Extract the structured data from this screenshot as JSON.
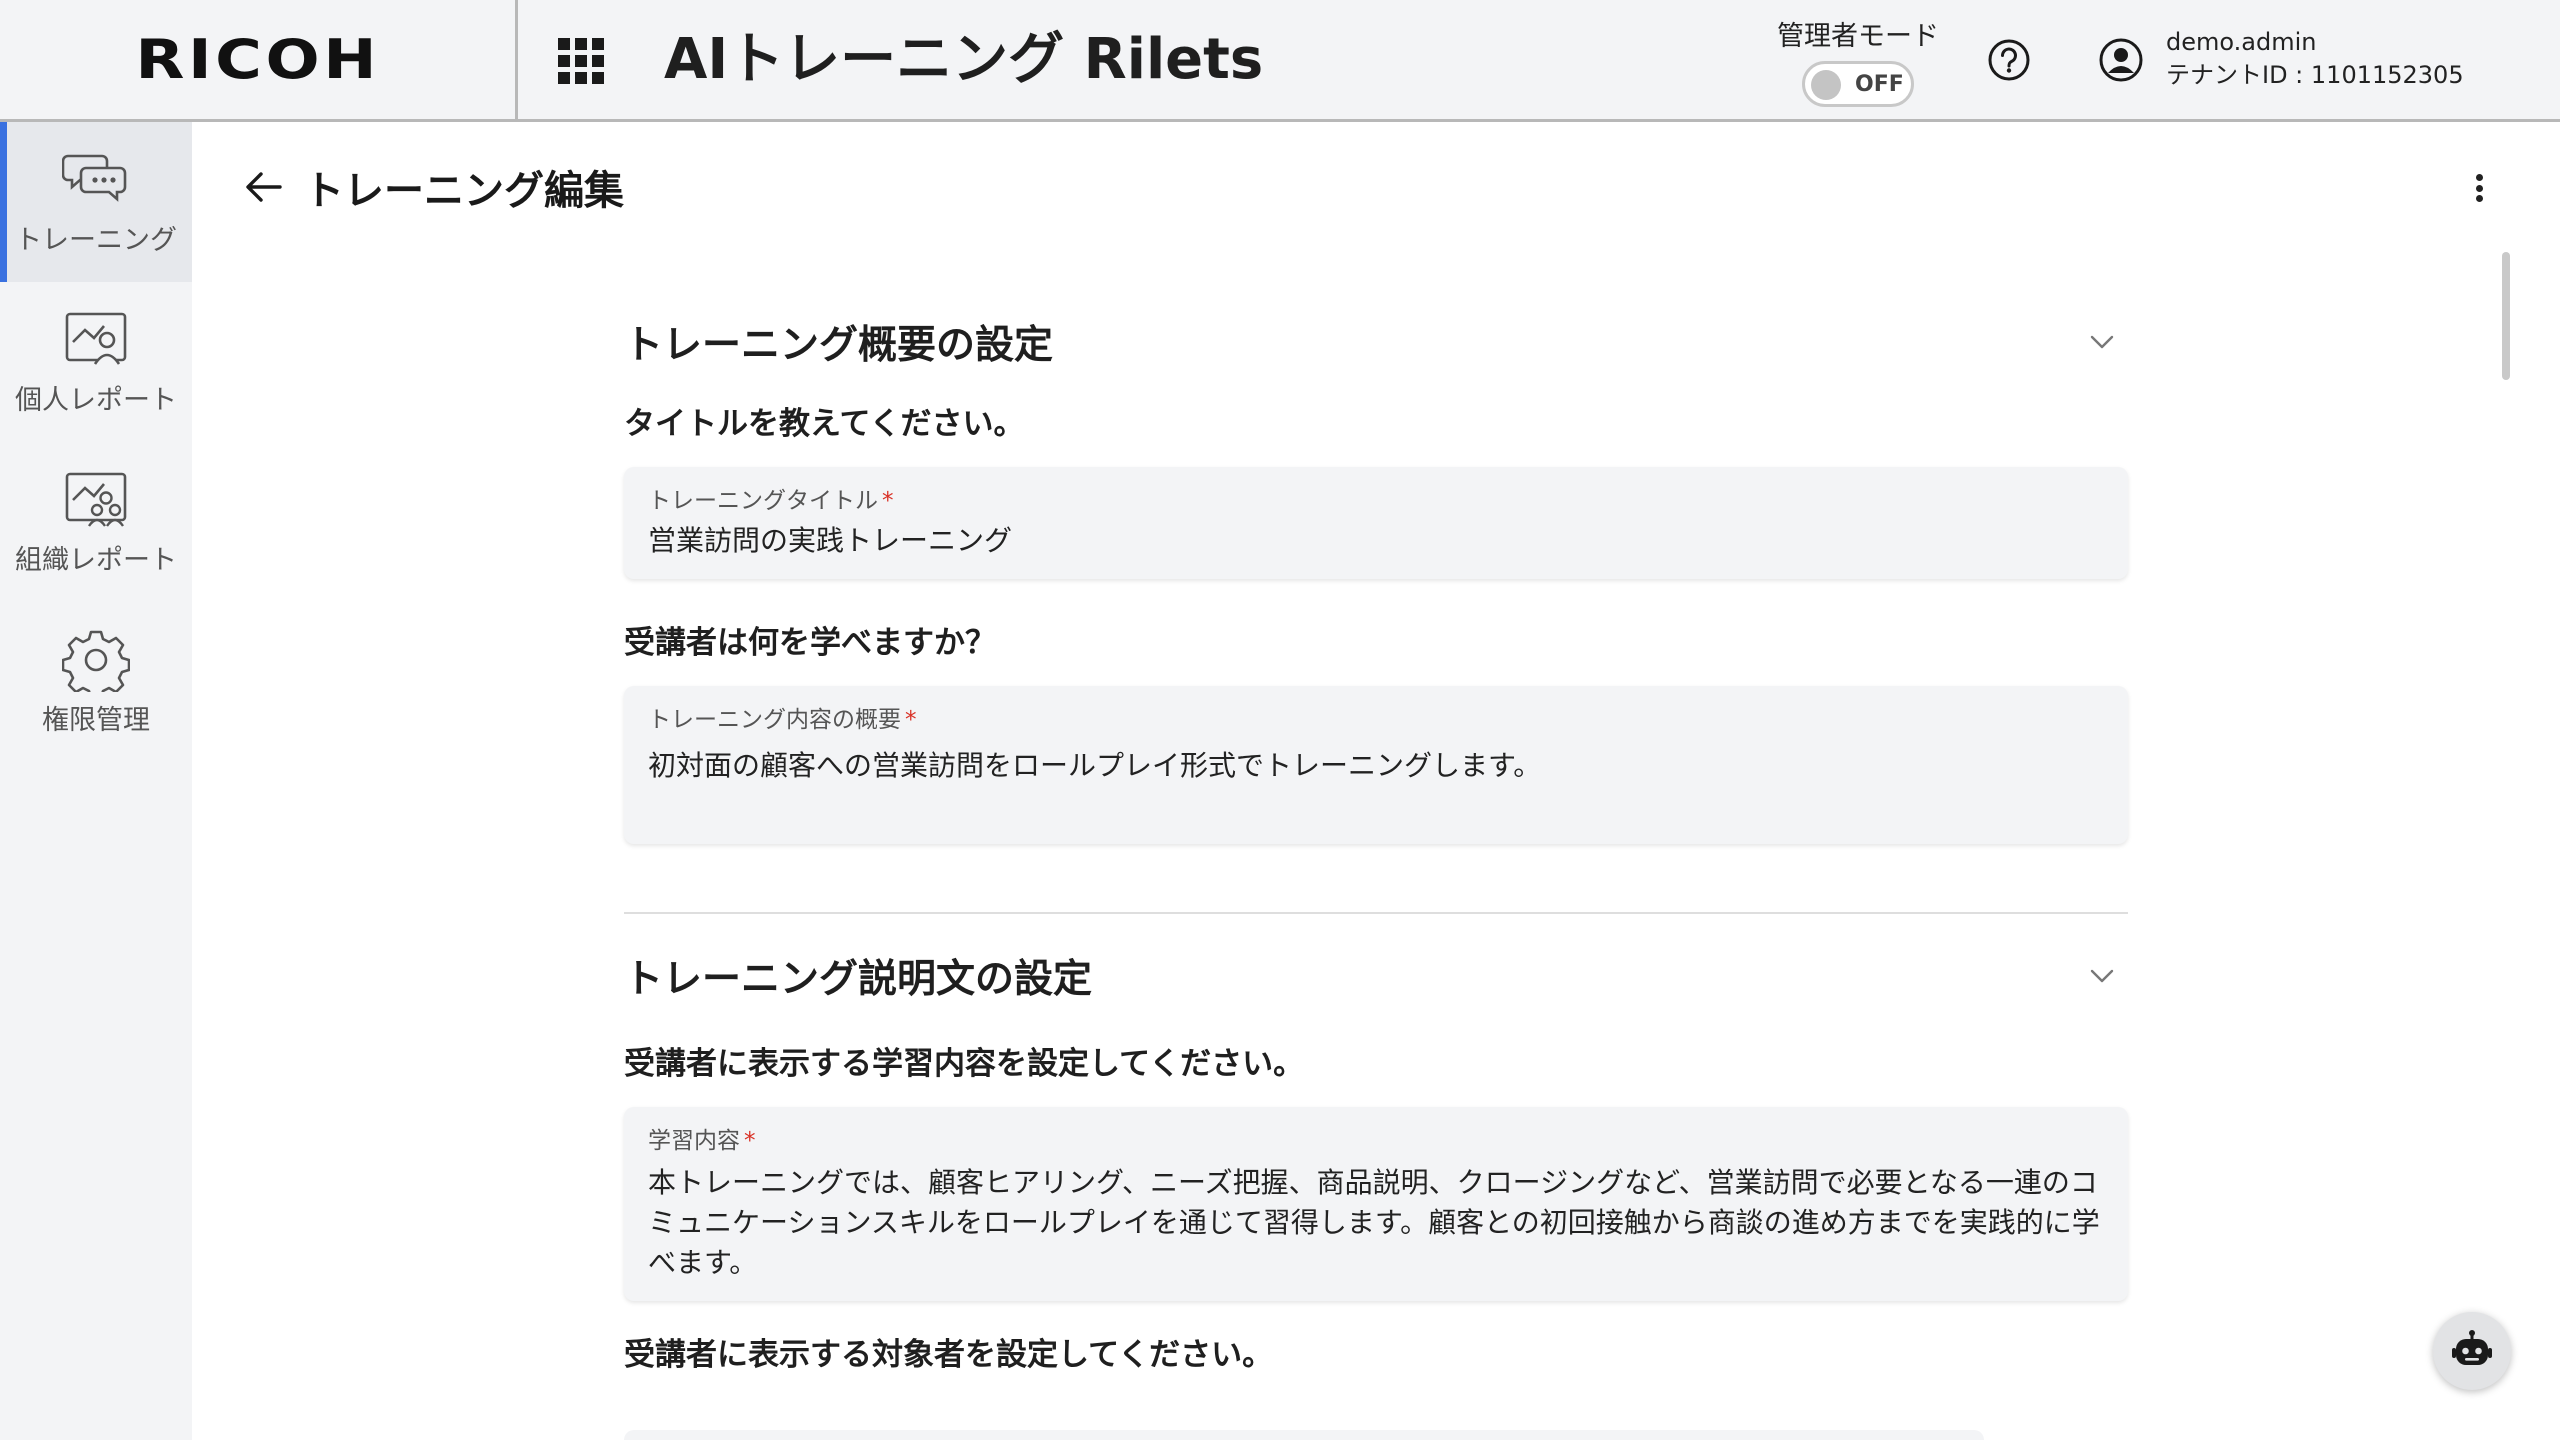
{
  "header": {
    "logo": "RICOH",
    "app_title": "AIトレーニング Rilets",
    "admin_mode": {
      "label": "管理者モード",
      "state": "OFF"
    },
    "user": {
      "name": "demo.admin",
      "tenant": "テナントID : 1101152305"
    }
  },
  "sidebar": {
    "items": [
      {
        "label": "トレーニング",
        "icon": "chat-bubbles-icon",
        "active": true
      },
      {
        "label": "個人レポート",
        "icon": "personal-report-icon",
        "active": false
      },
      {
        "label": "組織レポート",
        "icon": "organization-report-icon",
        "active": false
      },
      {
        "label": "権限管理",
        "icon": "gear-icon",
        "active": false
      }
    ]
  },
  "page": {
    "title": "トレーニング編集"
  },
  "sections": [
    {
      "title": "トレーニング概要の設定",
      "questions": [
        {
          "question": "タイトルを教えてください。",
          "field_label": "トレーニングタイトル",
          "required_mark": "*",
          "value": "営業訪問の実践トレーニング"
        },
        {
          "question": "受講者は何を学べますか？",
          "field_label": "トレーニング内容の概要",
          "required_mark": "*",
          "value": "初対面の顧客への営業訪問をロールプレイ形式でトレーニングします。"
        }
      ]
    },
    {
      "title": "トレーニング説明文の設定",
      "questions": [
        {
          "question": "受講者に表示する学習内容を設定してください。",
          "field_label": "学習内容",
          "required_mark": "*",
          "value": "本トレーニングでは、顧客ヒアリング、ニーズ把握、商品説明、クロージングなど、営業訪問で必要となる一連のコミュニケーションスキルをロールプレイを通じて習得します。顧客との初回接触から商談の進め方までを実践的に学べます。"
        },
        {
          "question": "受講者に表示する対象者を設定してください。"
        }
      ]
    }
  ],
  "colors": {
    "accent": "#3a71e0",
    "required": "#d93025",
    "header_bg": "#f3f4f6",
    "field_bg": "#f3f4f6"
  }
}
